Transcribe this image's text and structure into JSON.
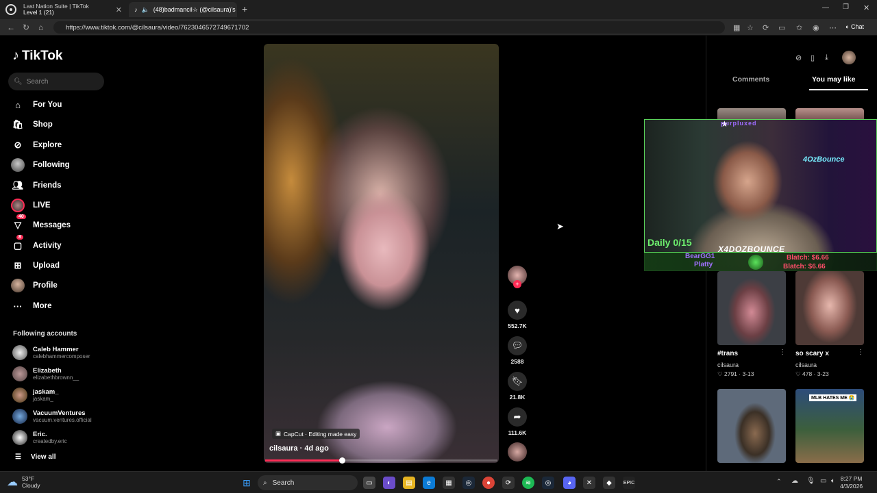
{
  "browser": {
    "tabs": [
      {
        "title": "Last Nation Suite | TikTok",
        "active": false
      },
      {
        "title": "(48)badmancil☆ (@cilsaura)'s",
        "active": true
      }
    ],
    "overlay_tab_text": "Level 1 (21)",
    "url": "https://www.tiktok.com/@cilsaura/video/7623046572749671702",
    "chat_label": "Chat"
  },
  "sidebar": {
    "logo": "TikTok",
    "search_placeholder": "Search",
    "nav": [
      {
        "label": "For You",
        "icon": "home-icon"
      },
      {
        "label": "Shop",
        "icon": "shop-icon"
      },
      {
        "label": "Explore",
        "icon": "compass-icon"
      },
      {
        "label": "Following",
        "icon": "following-avatar-icon"
      },
      {
        "label": "Friends",
        "icon": "friends-icon"
      },
      {
        "label": "LIVE",
        "icon": "live-avatar-icon"
      },
      {
        "label": "Messages",
        "icon": "messages-icon",
        "badge": "40"
      },
      {
        "label": "Activity",
        "icon": "activity-icon",
        "badge": "8"
      },
      {
        "label": "Upload",
        "icon": "upload-icon"
      },
      {
        "label": "Profile",
        "icon": "profile-avatar-icon"
      },
      {
        "label": "More",
        "icon": "more-dots-icon"
      }
    ],
    "following_title": "Following accounts",
    "accounts": [
      {
        "name": "Caleb Hammer",
        "handle": "calebhammercomposer"
      },
      {
        "name": "Elizabeth",
        "handle": "elizabethbrownn__"
      },
      {
        "name": "jaskam_",
        "handle": "jaskam_"
      },
      {
        "name": "VacuumVentures",
        "handle": "vacuum.ventures.official"
      },
      {
        "name": "Eric.",
        "handle": "createdby.eric"
      }
    ],
    "view_all": "View all"
  },
  "video": {
    "capcut": "CapCut · Editing made easy",
    "author_line": "cilsaura · 4d ago",
    "progress": 0.33
  },
  "actions": {
    "likes": "552.7K",
    "comments": "2588",
    "saves": "21.8K",
    "shares": "111.6K"
  },
  "right_panel": {
    "tab_comments": "Comments",
    "tab_you_may_like": "You may like",
    "cards": [
      {
        "title": "#trans",
        "author": "cilsaura",
        "likes": "2791",
        "date": "3-13"
      },
      {
        "title": "so scary x",
        "author": "cilsaura",
        "likes": "478",
        "date": "3-23"
      }
    ],
    "thumb_overlay_text_1": "MLB HATES ME 😭"
  },
  "stream_overlay": {
    "top_name": "purpluxed",
    "daily": "Daily 0/15",
    "streamer": "X4DOZBOUNCE",
    "left_names": [
      "BearGG1",
      "Platty"
    ],
    "right_lines": [
      "Blatch: $6.66",
      "Blatch: $6.66"
    ],
    "brand": "4OzBounce"
  },
  "taskbar": {
    "temp": "53°F",
    "condition": "Cloudy",
    "search": "Search",
    "time": "8:27 PM",
    "date": "4/3/2026"
  },
  "colors": {
    "accent": "#fe2c55",
    "overlay_green": "#6ef06e"
  }
}
